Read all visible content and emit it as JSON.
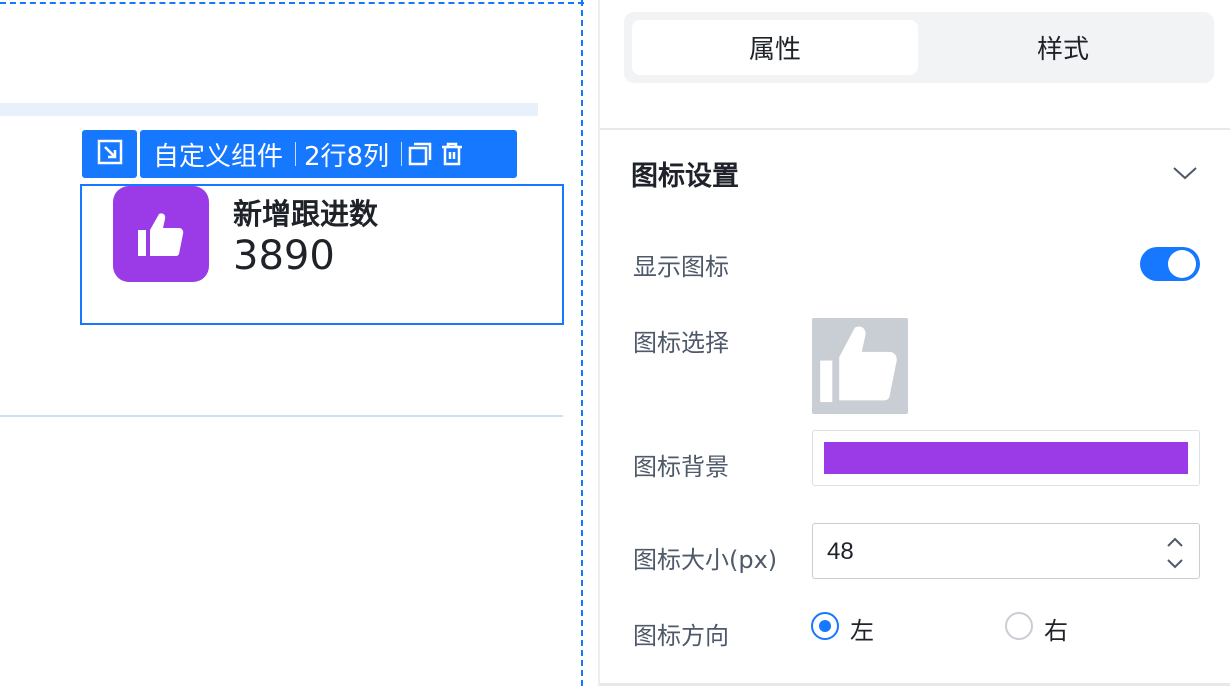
{
  "canvas": {
    "toolbar": {
      "component_name": "自定义组件",
      "grid_size": "2行8列",
      "resize_icon": "resize-icon",
      "copy_icon": "copy-icon",
      "delete_icon": "trash-icon"
    },
    "widget": {
      "title": "新增跟进数",
      "value": "3890",
      "icon": "thumbs-up-icon",
      "icon_bg": "#9b3be8"
    }
  },
  "panel": {
    "tabs": [
      {
        "label": "属性",
        "active": true
      },
      {
        "label": "样式",
        "active": false
      }
    ],
    "section_title": "图标设置",
    "fields": {
      "show_icon": {
        "label": "显示图标",
        "value": true
      },
      "icon_select": {
        "label": "图标选择",
        "icon": "thumbs-up-icon"
      },
      "icon_bg": {
        "label": "图标背景",
        "color": "#9b3be8"
      },
      "icon_size": {
        "label": "图标大小(px)",
        "value": "48"
      },
      "icon_direction": {
        "label": "图标方向",
        "options": [
          {
            "label": "左",
            "selected": true
          },
          {
            "label": "右",
            "selected": false
          }
        ]
      }
    }
  },
  "colors": {
    "accent": "#1677ff",
    "icon_purple": "#9b3be8",
    "placeholder_gray": "#c9cdd4"
  }
}
